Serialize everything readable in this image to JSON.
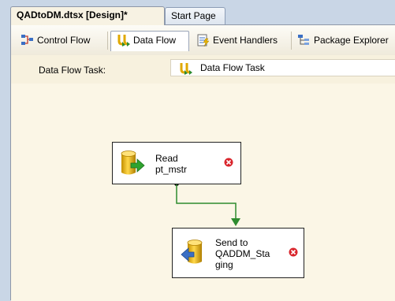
{
  "document_tabs": [
    {
      "label": "QADtoDM.dtsx [Design]*",
      "active": true
    },
    {
      "label": "Start Page",
      "active": false
    }
  ],
  "designer_tabs": [
    {
      "label": "Control Flow",
      "icon": "control-flow-icon"
    },
    {
      "label": "Data Flow",
      "icon": "data-flow-icon",
      "active": true
    },
    {
      "label": "Event Handlers",
      "icon": "event-handlers-icon"
    },
    {
      "label": "Package Explorer",
      "icon": "package-explorer-icon"
    }
  ],
  "task_bar": {
    "label": "Data Flow Task:",
    "selected": "Data Flow Task",
    "icon": "data-flow-task-icon"
  },
  "components": [
    {
      "name": "Read\npt_mstr",
      "type": "source",
      "icon": "source-cylinder-icon",
      "status": "error"
    },
    {
      "name": "Send to\nQADDM_Sta\nging",
      "type": "destination",
      "icon": "destination-cylinder-icon",
      "status": "error"
    }
  ],
  "colors": {
    "connector": "#2e8b2e",
    "error": "#d9252c",
    "cylinder": "#e8b400",
    "canvas": "#fbf6e6"
  }
}
